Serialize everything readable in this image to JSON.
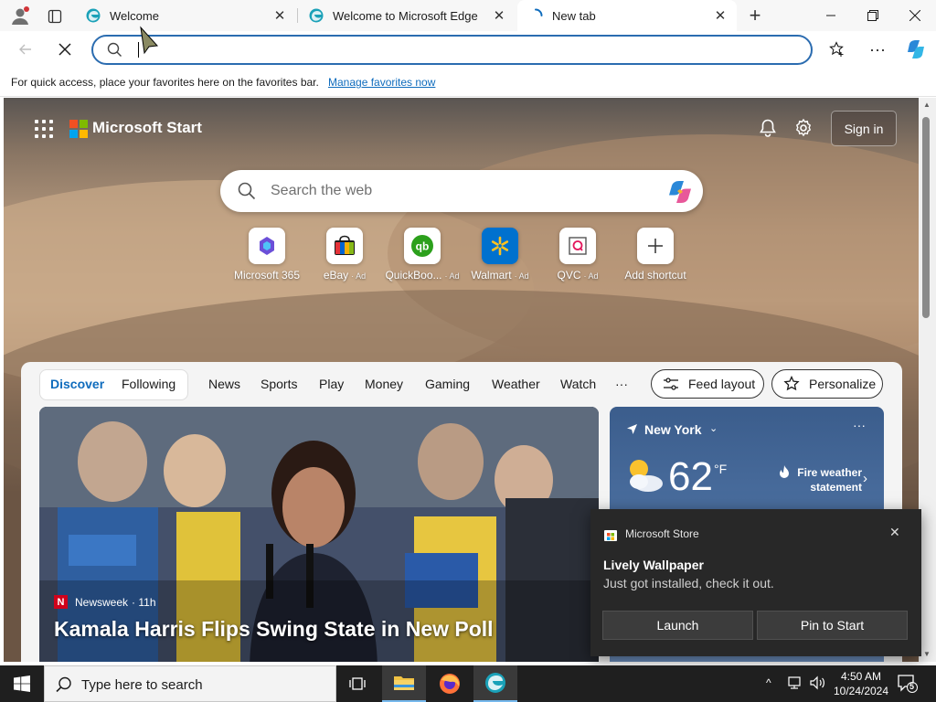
{
  "tabs": [
    {
      "label": "Welcome",
      "state": "normal"
    },
    {
      "label": "Welcome to Microsoft Edge",
      "state": "normal"
    },
    {
      "label": "New tab",
      "state": "loading",
      "active": true
    }
  ],
  "address": {
    "value": ""
  },
  "favorites_bar": {
    "message": "For quick access, place your favorites here on the favorites bar.",
    "link": "Manage favorites now"
  },
  "start": {
    "brand": "Microsoft Start",
    "sign_in": "Sign in",
    "search_placeholder": "Search the web",
    "quick_links": [
      {
        "name": "Microsoft 365",
        "ad": ""
      },
      {
        "name": "eBay",
        "ad": "Ad"
      },
      {
        "name": "QuickBoo...",
        "ad": "Ad"
      },
      {
        "name": "Walmart",
        "ad": "Ad"
      },
      {
        "name": "QVC",
        "ad": "Ad"
      },
      {
        "name": "Add shortcut",
        "ad": ""
      }
    ],
    "feed_tabs": [
      "Discover",
      "Following",
      "News",
      "Sports",
      "Play",
      "Money",
      "Gaming",
      "Weather",
      "Watch",
      "···"
    ],
    "feed_layout": "Feed layout",
    "personalize": "Personalize",
    "hero": {
      "source": "Newsweek",
      "age": "· 11h",
      "title": "Kamala Harris Flips Swing State in New Poll",
      "source_badge": "N"
    },
    "weather": {
      "city": "New York",
      "temp": "62",
      "unit": "°F",
      "alert_line1": "Fire weather",
      "alert_line2": "statement"
    }
  },
  "toast": {
    "app": "Microsoft Store",
    "title": "Lively Wallpaper",
    "body": "Just got installed, check it out.",
    "launch": "Launch",
    "pin": "Pin to Start"
  },
  "taskbar": {
    "search_placeholder": "Type here to search",
    "time": "4:50 AM",
    "date": "10/24/2024",
    "notifications": "5"
  },
  "colors": {
    "accent": "#0f6cbd",
    "toast_bg": "#282828",
    "taskbar_bg": "#1f1f1f"
  }
}
